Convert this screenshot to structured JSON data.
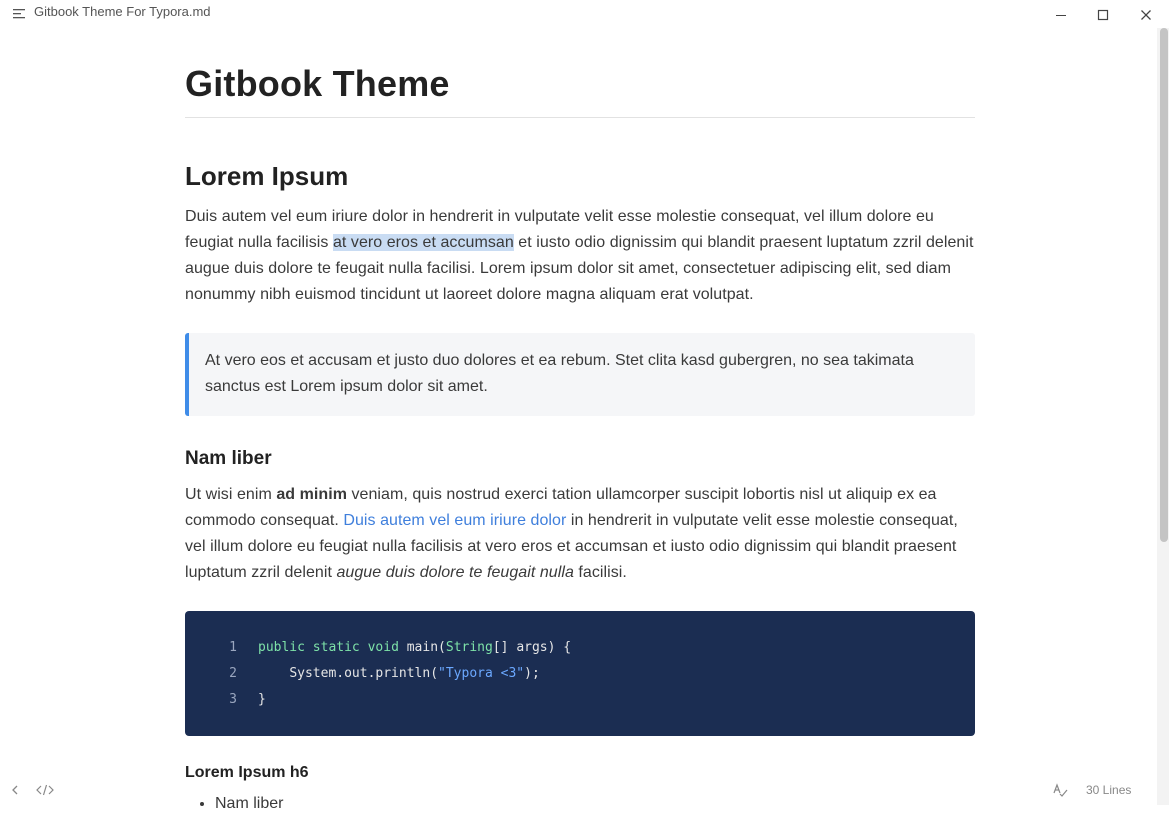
{
  "window": {
    "title": "Gitbook Theme For Typora.md"
  },
  "document": {
    "title": "Gitbook Theme",
    "section_heading": "Lorem Ipsum",
    "para1": {
      "before": "Duis autem vel eum iriure dolor in hendrerit in vulputate velit esse molestie consequat, vel illum dolore eu feugiat nulla facilisis ",
      "selected": "at vero eros et accumsan",
      "after": " et iusto odio dignissim qui blandit praesent luptatum zzril delenit augue duis dolore te feugait nulla facilisi. Lorem ipsum dolor sit amet, consectetuer adipiscing elit, sed diam nonummy nibh euismod tincidunt ut laoreet dolore magna aliquam erat volutpat."
    },
    "blockquote": "At vero eos et accusam et justo duo dolores et ea rebum. Stet clita kasd gubergren, no sea takimata sanctus est Lorem ipsum dolor sit amet.",
    "subheading": "Nam liber",
    "para2": {
      "part1": "Ut wisi enim ",
      "bold": "ad minim",
      "part2": " veniam, quis nostrud exerci tation ullamcorper suscipit lobortis nisl ut aliquip ex ea commodo consequat. ",
      "link": "Duis autem vel eum iriure dolor",
      "part3": " in hendrerit in vulputate velit esse molestie consequat, vel illum dolore eu feugiat nulla facilisis at vero eros et accumsan et iusto odio dignissim qui blandit praesent luptatum zzril delenit ",
      "italic": "augue duis dolore te feugait nulla",
      "part4": " facilisi."
    },
    "code": {
      "lines": [
        {
          "num": "1",
          "kw1": "public",
          "kw2": "static",
          "kw3": "void",
          "fn": " main(",
          "type": "String",
          "rest": "[] args) {"
        },
        {
          "num": "2",
          "indent": "    ",
          "call": "System.out.println(",
          "str": "\"Typora <3\"",
          "end": ");"
        },
        {
          "num": "3",
          "text": "}"
        }
      ]
    },
    "h6": "Lorem Ipsum h6",
    "list_items": [
      "Nam liber"
    ]
  },
  "statusbar": {
    "line_count": "30 Lines"
  },
  "icons": {
    "menu": "hamburger-menu-icon",
    "minimize": "minimize-icon",
    "maximize": "maximize-icon",
    "close": "close-icon",
    "back": "chevron-left-icon",
    "source": "source-code-icon",
    "spellcheck": "spellcheck-icon"
  },
  "colors": {
    "accent": "#3f8ce8",
    "link": "#3f7fdc",
    "code_bg": "#1b2d52",
    "selection": "#c9dcf3"
  }
}
